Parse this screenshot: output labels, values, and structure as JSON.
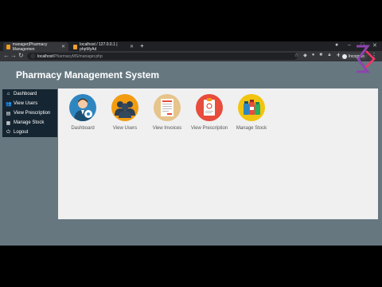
{
  "browser": {
    "tabs": [
      {
        "label": "manager|Pharmacy Managemen"
      },
      {
        "label": "localhost / 127.0.0.1 | phpMyAd"
      }
    ],
    "url_host": "localhost",
    "url_path": "/PharmacyMS/manager.php",
    "profile_label": "Incognito"
  },
  "app": {
    "title": "Pharmacy Management System"
  },
  "sidebar": {
    "items": [
      {
        "label": "Dashboard",
        "icon": "home-icon"
      },
      {
        "label": "View Users",
        "icon": "users-icon"
      },
      {
        "label": "View Prescription",
        "icon": "document-icon"
      },
      {
        "label": "Manage Stock",
        "icon": "stock-icon"
      },
      {
        "label": "Logout",
        "icon": "logout-icon"
      }
    ]
  },
  "tiles": [
    {
      "label": "Dashboard",
      "icon": "admin-user-icon",
      "color": "#2e86c1"
    },
    {
      "label": "View Users",
      "icon": "users-group-icon",
      "color": "#f39c12"
    },
    {
      "label": "View Invoices",
      "icon": "invoice-icon",
      "color": "#e6c48a"
    },
    {
      "label": "View Prescription",
      "icon": "prescription-clipboard-icon",
      "color": "#e74c3c"
    },
    {
      "label": "Manage Stock",
      "icon": "medicine-bottles-icon",
      "color": "#f1c40f"
    }
  ],
  "colors": {
    "header_bg": "#667780",
    "sidebar_bg": "#152531",
    "content_bg": "#f0f0f0"
  }
}
